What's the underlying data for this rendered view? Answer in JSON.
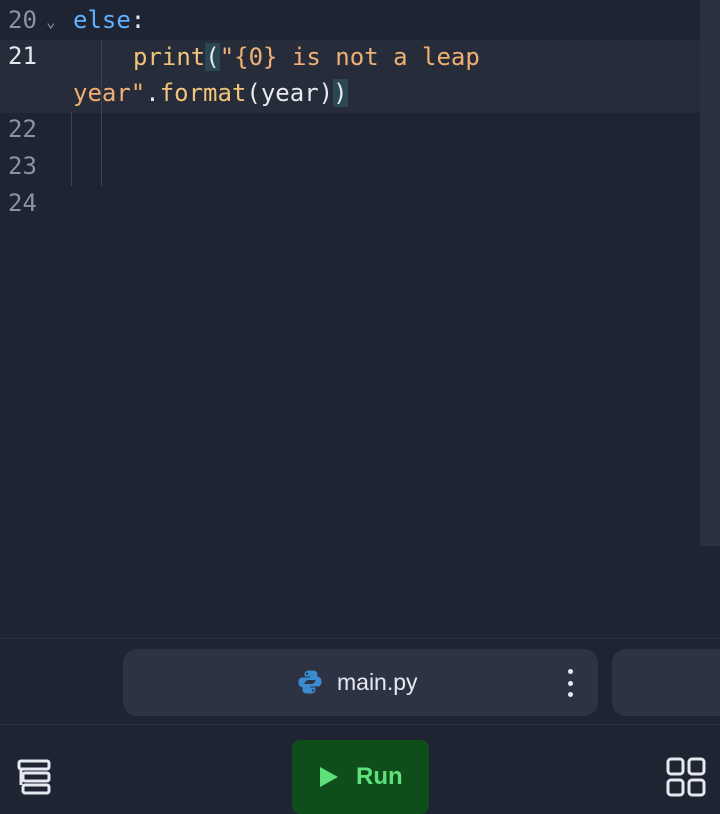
{
  "editor": {
    "line_numbers": [
      "20",
      "21",
      "",
      "22",
      "23",
      "24"
    ],
    "line20": {
      "keyword": "else",
      "colon": ":"
    },
    "line21": {
      "fn": "print",
      "open": "(",
      "str_part1": "\"{0} is not a leap",
      "str_part2": "year\"",
      "dot": ".",
      "method": "format",
      "open2": "(",
      "arg": "year",
      "close2": ")",
      "close": ")"
    },
    "fold_icon": "chevron-down-icon"
  },
  "tabbar": {
    "active_tab": {
      "label": "main.py",
      "icon": "python-icon",
      "menu_icon": "kebab-menu-icon"
    }
  },
  "bottombar": {
    "left_icon": "files-stack-icon",
    "run_label": "Run",
    "run_icon": "play-icon",
    "right_icon": "grid-icon",
    "run_color": "#5ee07a",
    "run_bg": "#0f4d1b"
  }
}
